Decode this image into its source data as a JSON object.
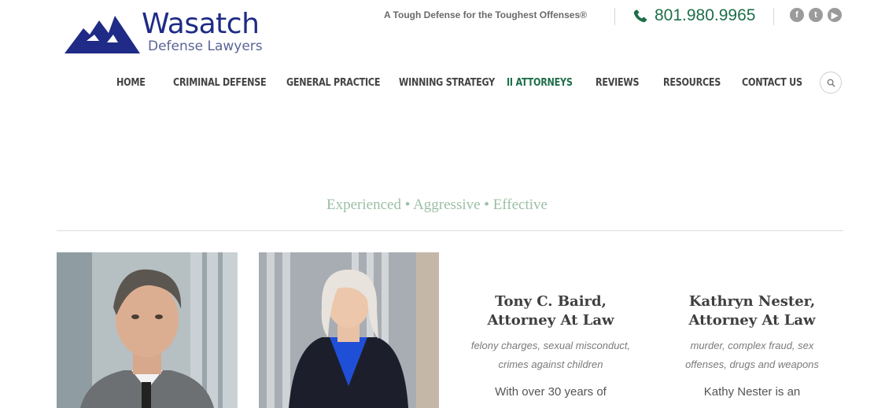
{
  "brand": {
    "name": "Wasatch",
    "subtitle": "Defense Lawyers",
    "color": "#1f2b86"
  },
  "header": {
    "tagline": "A Tough Defense for the Toughest Offenses®",
    "phone": "801.980.9965",
    "phone_color": "#1e6e4a",
    "socials": [
      {
        "name": "facebook-icon",
        "glyph": "f"
      },
      {
        "name": "twitter-icon",
        "glyph": "t"
      },
      {
        "name": "youtube-icon",
        "glyph": "▶"
      }
    ]
  },
  "nav": {
    "items": [
      {
        "label": "HOME",
        "active": false
      },
      {
        "label": "CRIMINAL DEFENSE",
        "active": false
      },
      {
        "label": "GENERAL PRACTICE",
        "active": false
      },
      {
        "label": "WINNING STRATEGY",
        "active": false
      },
      {
        "label": "II ATTORNEYS",
        "active": true
      },
      {
        "label": "REVIEWS",
        "active": false
      },
      {
        "label": "RESOURCES",
        "active": false
      },
      {
        "label": "CONTACT US",
        "active": false
      }
    ]
  },
  "main": {
    "slogan": "Experienced • Aggressive • Effective",
    "attorneys": [
      {
        "name_line1": "Tony C. Baird,",
        "name_line2": "Attorney At Law",
        "spec_line1": "felony charges, sexual misconduct,",
        "spec_line2": "crimes against children",
        "bio": "With over 30 years of"
      },
      {
        "name_line1": "Kathryn Nester,",
        "name_line2": "Attorney At Law",
        "spec_line1": "murder, complex fraud, sex",
        "spec_line2": "offenses, drugs and weapons",
        "bio": "Kathy Nester is an"
      }
    ]
  }
}
